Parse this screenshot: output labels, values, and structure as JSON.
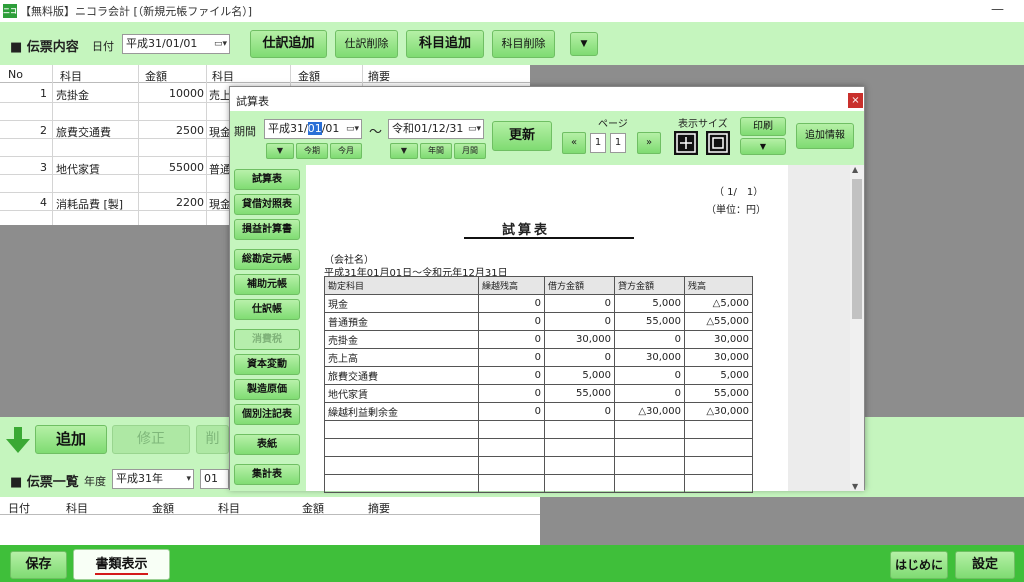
{
  "window": {
    "title": "【無料版】ニコラ会計 [（新規元帳ファイル名）]",
    "app_icon": "ニコ"
  },
  "slip_entry": {
    "title": "■ 伝票内容",
    "date_label": "日付",
    "date_value": "平成31/01/01",
    "buttons": {
      "add_entry": "仕訳追加",
      "delete_entry": "仕訳削除",
      "add_account": "科目追加",
      "delete_account": "科目削除",
      "more": "▼"
    }
  },
  "slip_table": {
    "headers": [
      "No",
      "科目",
      "金額",
      "科目",
      "金額",
      "摘要"
    ],
    "rows": [
      {
        "no": "1",
        "account": "売掛金",
        "amount": "10000",
        "account2": "売上"
      },
      {
        "no": "2",
        "account": "旅費交通費",
        "amount": "2500",
        "account2": "現金"
      },
      {
        "no": "3",
        "account": "地代家賃",
        "amount": "55000",
        "account2": "普通"
      },
      {
        "no": "4",
        "account": "消耗品費 [製]",
        "amount": "2200",
        "account2": "現金"
      }
    ]
  },
  "action_bar": {
    "add": "追加",
    "edit": "修正",
    "delete_partial": "削"
  },
  "slip_list": {
    "title": "■ 伝票一覧",
    "year_label": "年度",
    "year_value": "平成31年",
    "month_partial": "01",
    "headers": [
      "日付",
      "科目",
      "金額",
      "科目",
      "金額",
      "摘要"
    ]
  },
  "footer": {
    "save": "保存",
    "show_docs": "書類表示",
    "intro": "はじめに",
    "settings": "設定"
  },
  "dialog": {
    "title": "試算表",
    "close": "×",
    "period_label": "期間",
    "from_date_prefix": "平成31/",
    "from_date_selected": "01",
    "from_date_suffix": "/01",
    "tilde": "～",
    "to_date": "令和01/12/31",
    "from_buttons": {
      "down": "▼",
      "this_term": "今期",
      "this_month": "今月"
    },
    "to_buttons": {
      "down": "▼",
      "year": "年間",
      "month": "月間"
    },
    "update": "更新",
    "page_label": "ページ",
    "page_prev": "«",
    "page_current": "1",
    "page_total": "1",
    "page_next": "»",
    "size_label": "表示サイズ",
    "print": "印刷",
    "print_down": "▼",
    "extra_info": "追加情報",
    "side_menu": [
      "試算表",
      "貸借対照表",
      "損益計算書",
      "総勘定元帳",
      "補助元帳",
      "仕訳帳",
      "消費税",
      "資本変動",
      "製造原価",
      "個別注記表",
      "表紙",
      "集計表"
    ],
    "report": {
      "page_indicator": "（ 1/　1）",
      "unit": "（単位：円）",
      "heading": "試算表",
      "company": "（会社名）",
      "period": "平成31年01月01日～令和元年12月31日",
      "headers": [
        "勘定科目",
        "繰越残高",
        "借方金額",
        "貸方金額",
        "残高"
      ],
      "rows": [
        [
          "現金",
          "0",
          "0",
          "5,000",
          "△5,000"
        ],
        [
          "普通預金",
          "0",
          "0",
          "55,000",
          "△55,000"
        ],
        [
          "売掛金",
          "0",
          "30,000",
          "0",
          "30,000"
        ],
        [
          "売上高",
          "0",
          "0",
          "30,000",
          "30,000"
        ],
        [
          "旅費交通費",
          "0",
          "5,000",
          "0",
          "5,000"
        ],
        [
          "地代家賃",
          "0",
          "55,000",
          "0",
          "55,000"
        ],
        [
          "繰越利益剰余金",
          "0",
          "0",
          "△30,000",
          "△30,000"
        ]
      ]
    }
  },
  "colors": {
    "panel_green": "#c5f5be",
    "button_green": "#7fdb72",
    "footer_green": "#3fbf3a",
    "gray_area": "#8d8d8d",
    "close_red": "#c9302c"
  }
}
